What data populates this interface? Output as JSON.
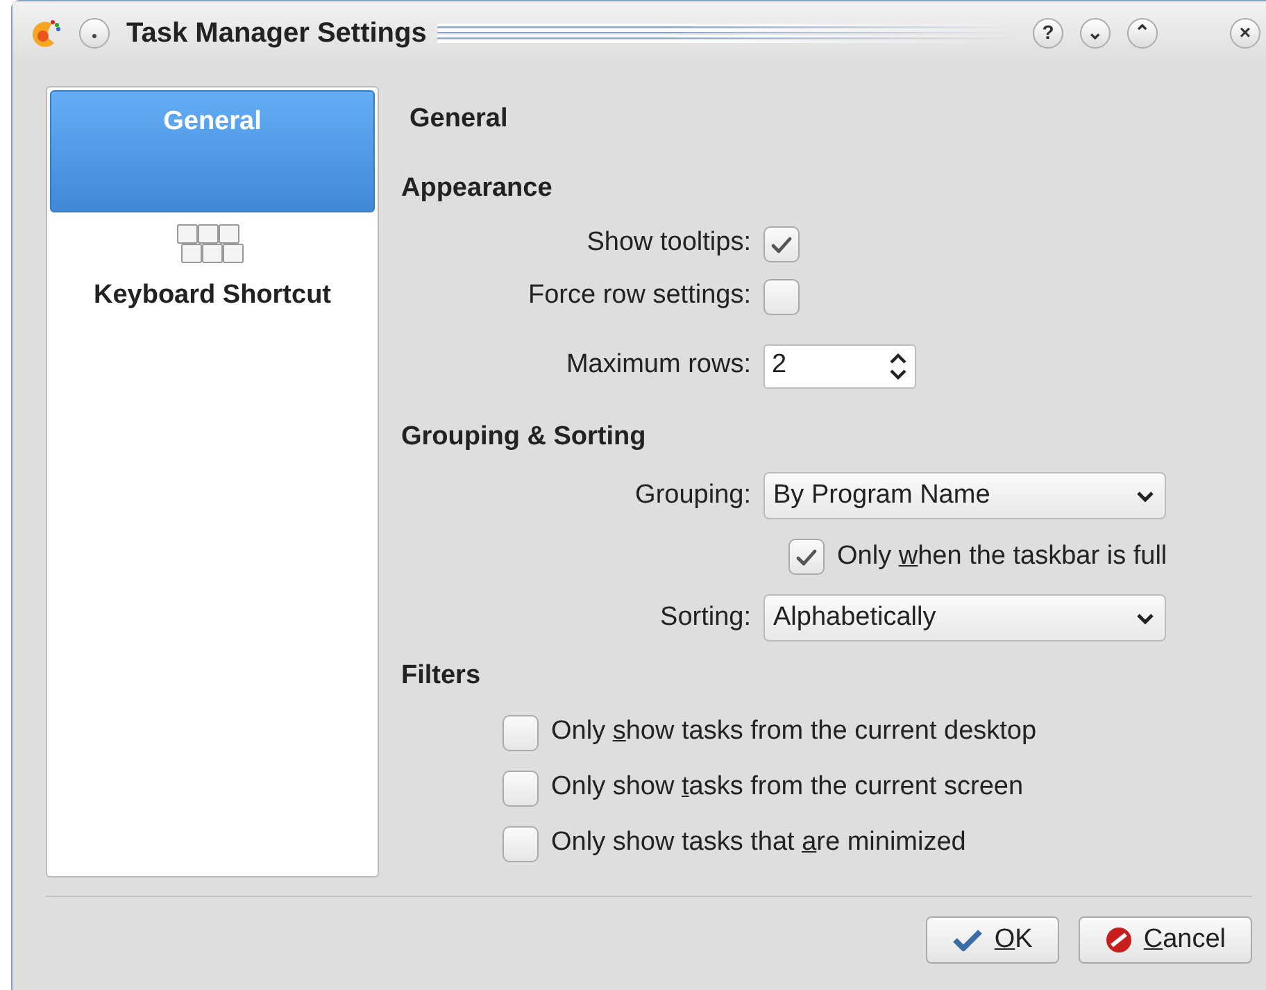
{
  "window": {
    "title": "Task Manager Settings",
    "buttons": [
      "?",
      "⌄",
      "⌃",
      "×"
    ]
  },
  "sidebar": {
    "items": [
      {
        "label": "General",
        "kind": "text",
        "selected": true
      },
      {
        "label": "Keyboard Shortcut",
        "kind": "keyboard",
        "selected": false
      }
    ]
  },
  "page_title": "General",
  "sections": [
    {
      "heading": "Appearance",
      "rows": [
        {
          "kind": "checkbox",
          "label": "Show tooltips:",
          "checked": true
        },
        {
          "kind": "checkbox",
          "label": "Force row settings:",
          "checked": false
        },
        {
          "kind": "spin",
          "label": "Maximum rows:",
          "value": "2"
        }
      ]
    },
    {
      "heading": "Grouping & Sorting",
      "rows": [
        {
          "kind": "select",
          "label": "Grouping:",
          "value": "By Program Name"
        },
        {
          "kind": "option",
          "before": "Only ",
          "key": "w",
          "after": "hen the taskbar is full",
          "checked": true
        },
        {
          "kind": "select",
          "label": "Sorting:",
          "value": "Alphabetically"
        }
      ]
    },
    {
      "heading": "Filters",
      "rows": [
        {
          "kind": "filter",
          "before": "Only ",
          "key": "s",
          "after": "how tasks from the current desktop",
          "checked": false
        },
        {
          "kind": "filter",
          "before": "Only show ",
          "key": "t",
          "after": "asks from the current screen",
          "checked": false
        },
        {
          "kind": "filter",
          "before": "Only show tasks that ",
          "key": "a",
          "after": "re minimized",
          "checked": false
        }
      ]
    }
  ],
  "footer_buttons": [
    {
      "kind": "ok",
      "key": "O",
      "after": "K"
    },
    {
      "kind": "cancel",
      "key": "C",
      "after": "ancel"
    }
  ]
}
